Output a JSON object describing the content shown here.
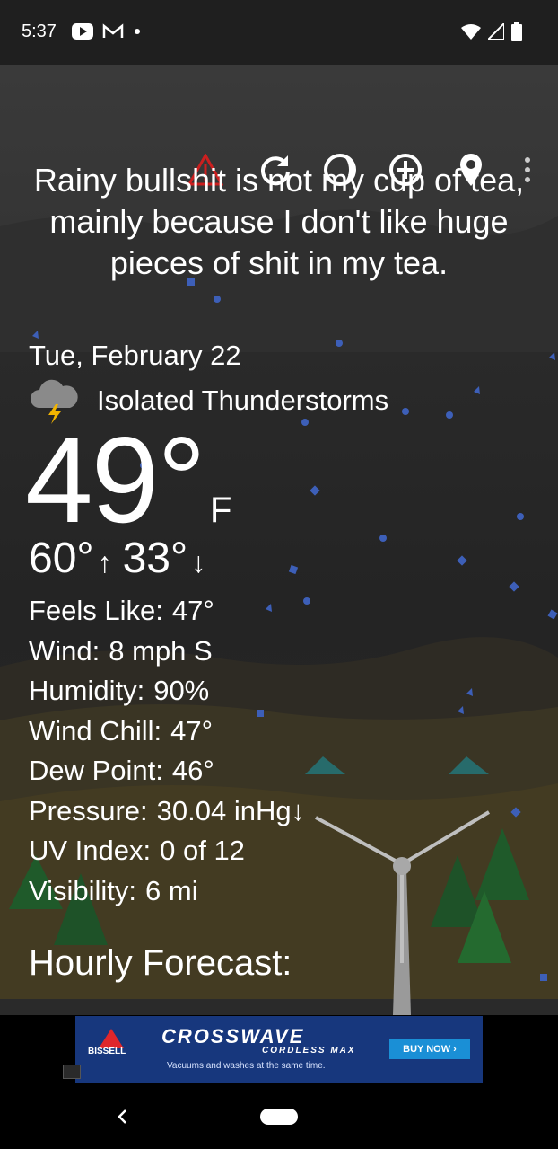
{
  "status_bar": {
    "time": "5:37",
    "left_icons": [
      "youtube-icon",
      "gmail-icon",
      "dot-icon"
    ],
    "right_icons": [
      "wifi-icon",
      "signal-icon",
      "battery-icon"
    ]
  },
  "toolbar": {
    "buttons": [
      "alert-icon",
      "refresh-icon",
      "theme-icon",
      "add-location-icon",
      "location-pin-icon",
      "more-vert-icon"
    ],
    "alert_color": "#cc1f1f"
  },
  "quote": "Rainy bullshit is not my cup of tea, mainly because I don't like huge pieces of shit in my tea.",
  "weather": {
    "date": "Tue, February 22",
    "condition": "Isolated Thunderstorms",
    "condition_icon": "thunderstorm-cloud-icon",
    "temperature": "49°",
    "unit": "F",
    "high": "60°",
    "high_arrow": "↑",
    "low": "33°",
    "low_arrow": "↓"
  },
  "details": [
    {
      "label": "Feels Like:",
      "value": "47°"
    },
    {
      "label": "Wind:",
      "value": "8 mph S"
    },
    {
      "label": "Humidity:",
      "value": "90%"
    },
    {
      "label": "Wind Chill:",
      "value": "47°"
    },
    {
      "label": "Dew Point:",
      "value": "46°"
    },
    {
      "label": "Pressure:",
      "value": "30.04 inHg↓"
    },
    {
      "label": "UV Index:",
      "value": "0 of 12"
    },
    {
      "label": "Visibility:",
      "value": "6 mi"
    }
  ],
  "hourly_heading": "Hourly Forecast:",
  "ad": {
    "brand": "BISSELL",
    "title": "CROSSWAVE",
    "subtitle": "CORDLESS MAX",
    "description": "Vacuums and washes at the same time.",
    "cta": "BUY NOW ›"
  },
  "colors": {
    "rain": "#3d5fb8",
    "accent_alert": "#cc1f1f"
  }
}
